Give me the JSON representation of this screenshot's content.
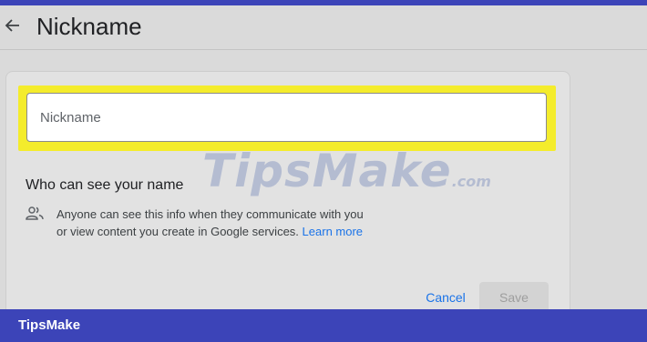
{
  "header": {
    "back_icon": "arrow-back-icon",
    "title": "Nickname"
  },
  "nickname_field": {
    "placeholder": "Nickname",
    "value": "",
    "highlight_color": "#f4ec2c"
  },
  "visibility": {
    "heading": "Who can see your name",
    "icon": "people-icon",
    "description": "Anyone can see this info when they communicate with you or view content you create in Google services.",
    "learn_more": "Learn more"
  },
  "actions": {
    "cancel_label": "Cancel",
    "save_label": "Save"
  },
  "watermark": {
    "text": "TipsMake",
    "suffix": ".com"
  },
  "footer": {
    "brand": "TipsMake"
  },
  "colors": {
    "accent": "#1a73e8",
    "footer_bar": "#3c44b8"
  }
}
